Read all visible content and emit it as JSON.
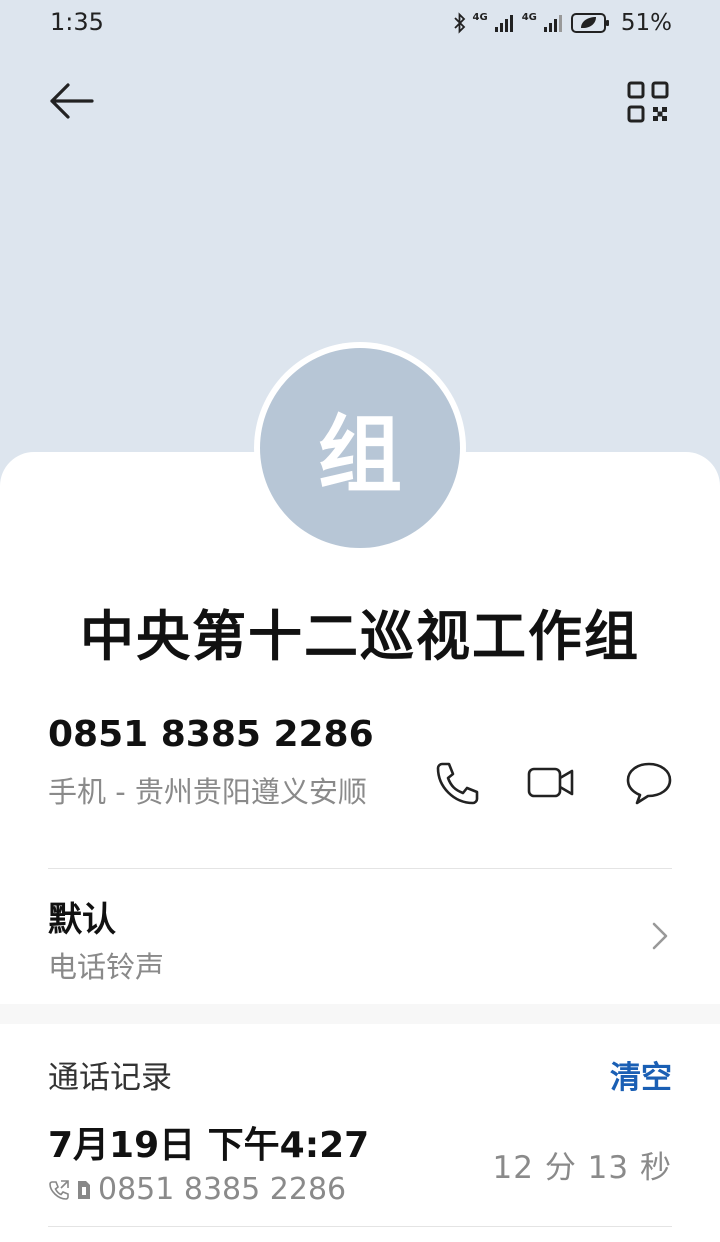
{
  "status_bar": {
    "time": "1:35",
    "network_1": "4G",
    "network_2": "4G",
    "battery": "51%",
    "icons": [
      "bluetooth-icon",
      "signal-icon",
      "signal-icon",
      "battery-icon"
    ]
  },
  "header": {
    "back_icon": "arrow-left-icon",
    "qr_icon": "qr-code-icon"
  },
  "contact": {
    "avatar_letter": "组",
    "name": "中央第十二巡视工作组",
    "phone": "0851 8385 2286",
    "phone_location": "手机 - 贵州贵阳遵义安顺",
    "actions": [
      "phone-icon",
      "video-call-icon",
      "message-icon"
    ]
  },
  "ringtone": {
    "title": "默认",
    "subtitle": "电话铃声"
  },
  "call_log": {
    "title": "通话记录",
    "clear_label": "清空",
    "entries": [
      {
        "datetime": "7月19日 下午4:27",
        "number": "0851 8385 2286",
        "duration": "12 分 13 秒"
      }
    ]
  },
  "colors": {
    "header_bg": "#dde5ee",
    "avatar_bg": "#b7c6d6",
    "accent": "#1a5fb4"
  }
}
